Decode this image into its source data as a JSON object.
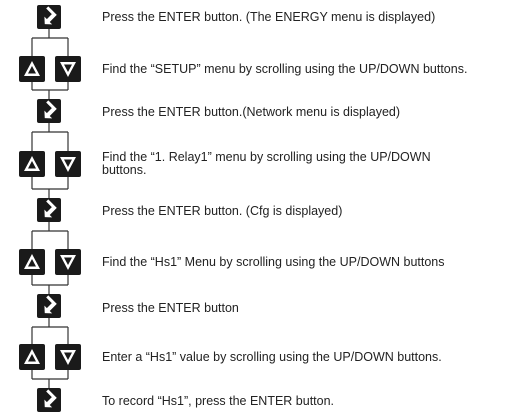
{
  "steps": [
    {
      "kind": "enter",
      "text": "Press the ENTER button. (The ENERGY menu is displayed)",
      "icons": [
        "enter-icon"
      ]
    },
    {
      "kind": "updown",
      "text": "Find the “SETUP” menu by scrolling using the UP/DOWN buttons.",
      "icons": [
        "up-arrow-icon",
        "down-arrow-icon"
      ]
    },
    {
      "kind": "enter",
      "text": "Press the ENTER button.(Network menu is displayed)",
      "icons": [
        "enter-icon"
      ]
    },
    {
      "kind": "updown",
      "text": "Find the “1. Relay1” menu by scrolling using the UP/DOWN buttons.",
      "icons": [
        "up-arrow-icon",
        "down-arrow-icon"
      ]
    },
    {
      "kind": "enter",
      "text": "Press the ENTER button. (Cfg is displayed)",
      "icons": [
        "enter-icon"
      ]
    },
    {
      "kind": "updown",
      "text": "Find the “Hs1” Menu by scrolling using the UP/DOWN buttons",
      "icons": [
        "up-arrow-icon",
        "down-arrow-icon"
      ]
    },
    {
      "kind": "enter",
      "text": "Press the ENTER button",
      "icons": [
        "enter-icon"
      ]
    },
    {
      "kind": "updown",
      "text": "Enter a “Hs1” value by scrolling using the UP/DOWN buttons.",
      "icons": [
        "up-arrow-icon",
        "down-arrow-icon"
      ]
    },
    {
      "kind": "enter",
      "text": "To record “Hs1”,  press the ENTER button.",
      "icons": [
        "enter-icon"
      ]
    }
  ],
  "colors": {
    "icon_fill": "#1a1a1a",
    "icon_glyph": "#ffffff",
    "connector": "#333333",
    "text": "#222222"
  }
}
